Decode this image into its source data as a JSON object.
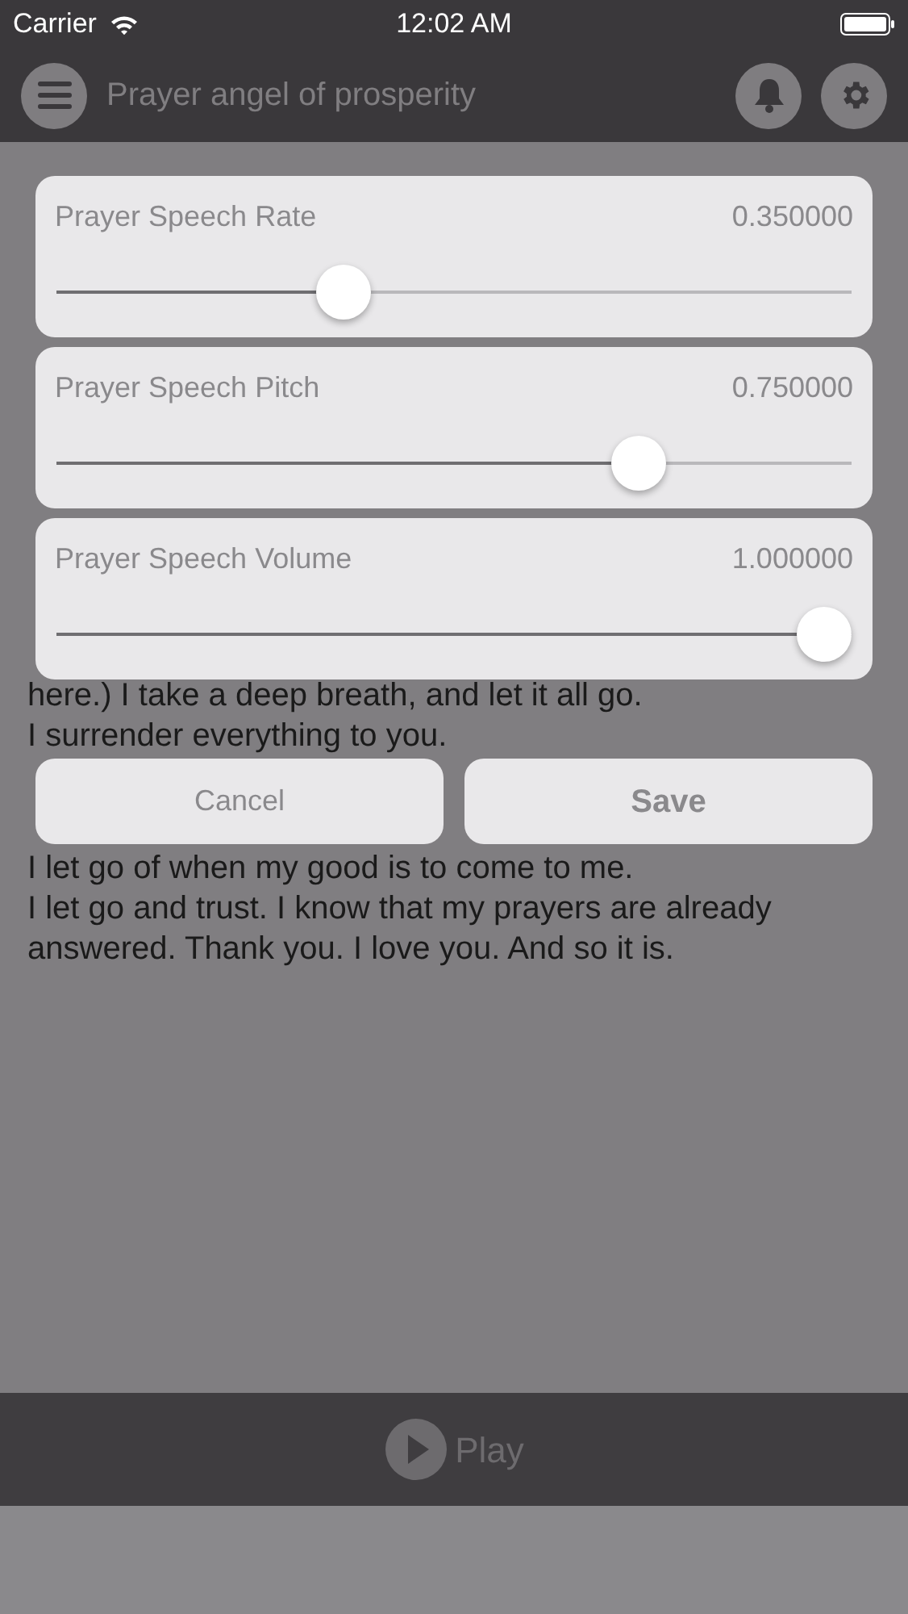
{
  "status_bar": {
    "carrier": "Carrier",
    "time": "12:02 AM"
  },
  "nav": {
    "title": "Prayer angel of prosperity"
  },
  "prayer_lines": [
    "here.) I take a deep breath, and let it all go.",
    "I surrender everything to you.",
    "I let go of when my good is to come to me.",
    "I let go and trust. I know that my prayers are already answered. Thank you. I love you. And so it is."
  ],
  "settings": [
    {
      "label": "Prayer Speech Rate",
      "reading": "0.350000",
      "level": 0.35
    },
    {
      "label": "Prayer Speech Pitch",
      "reading": "0.750000",
      "level": 0.75
    },
    {
      "label": "Prayer Speech Volume",
      "reading": "1.000000",
      "level": 1.0
    }
  ],
  "buttons": [
    {
      "label": "Cancel",
      "kind": "cancel"
    },
    {
      "label": "Save",
      "kind": "save"
    }
  ],
  "player": {
    "label": "Play"
  }
}
